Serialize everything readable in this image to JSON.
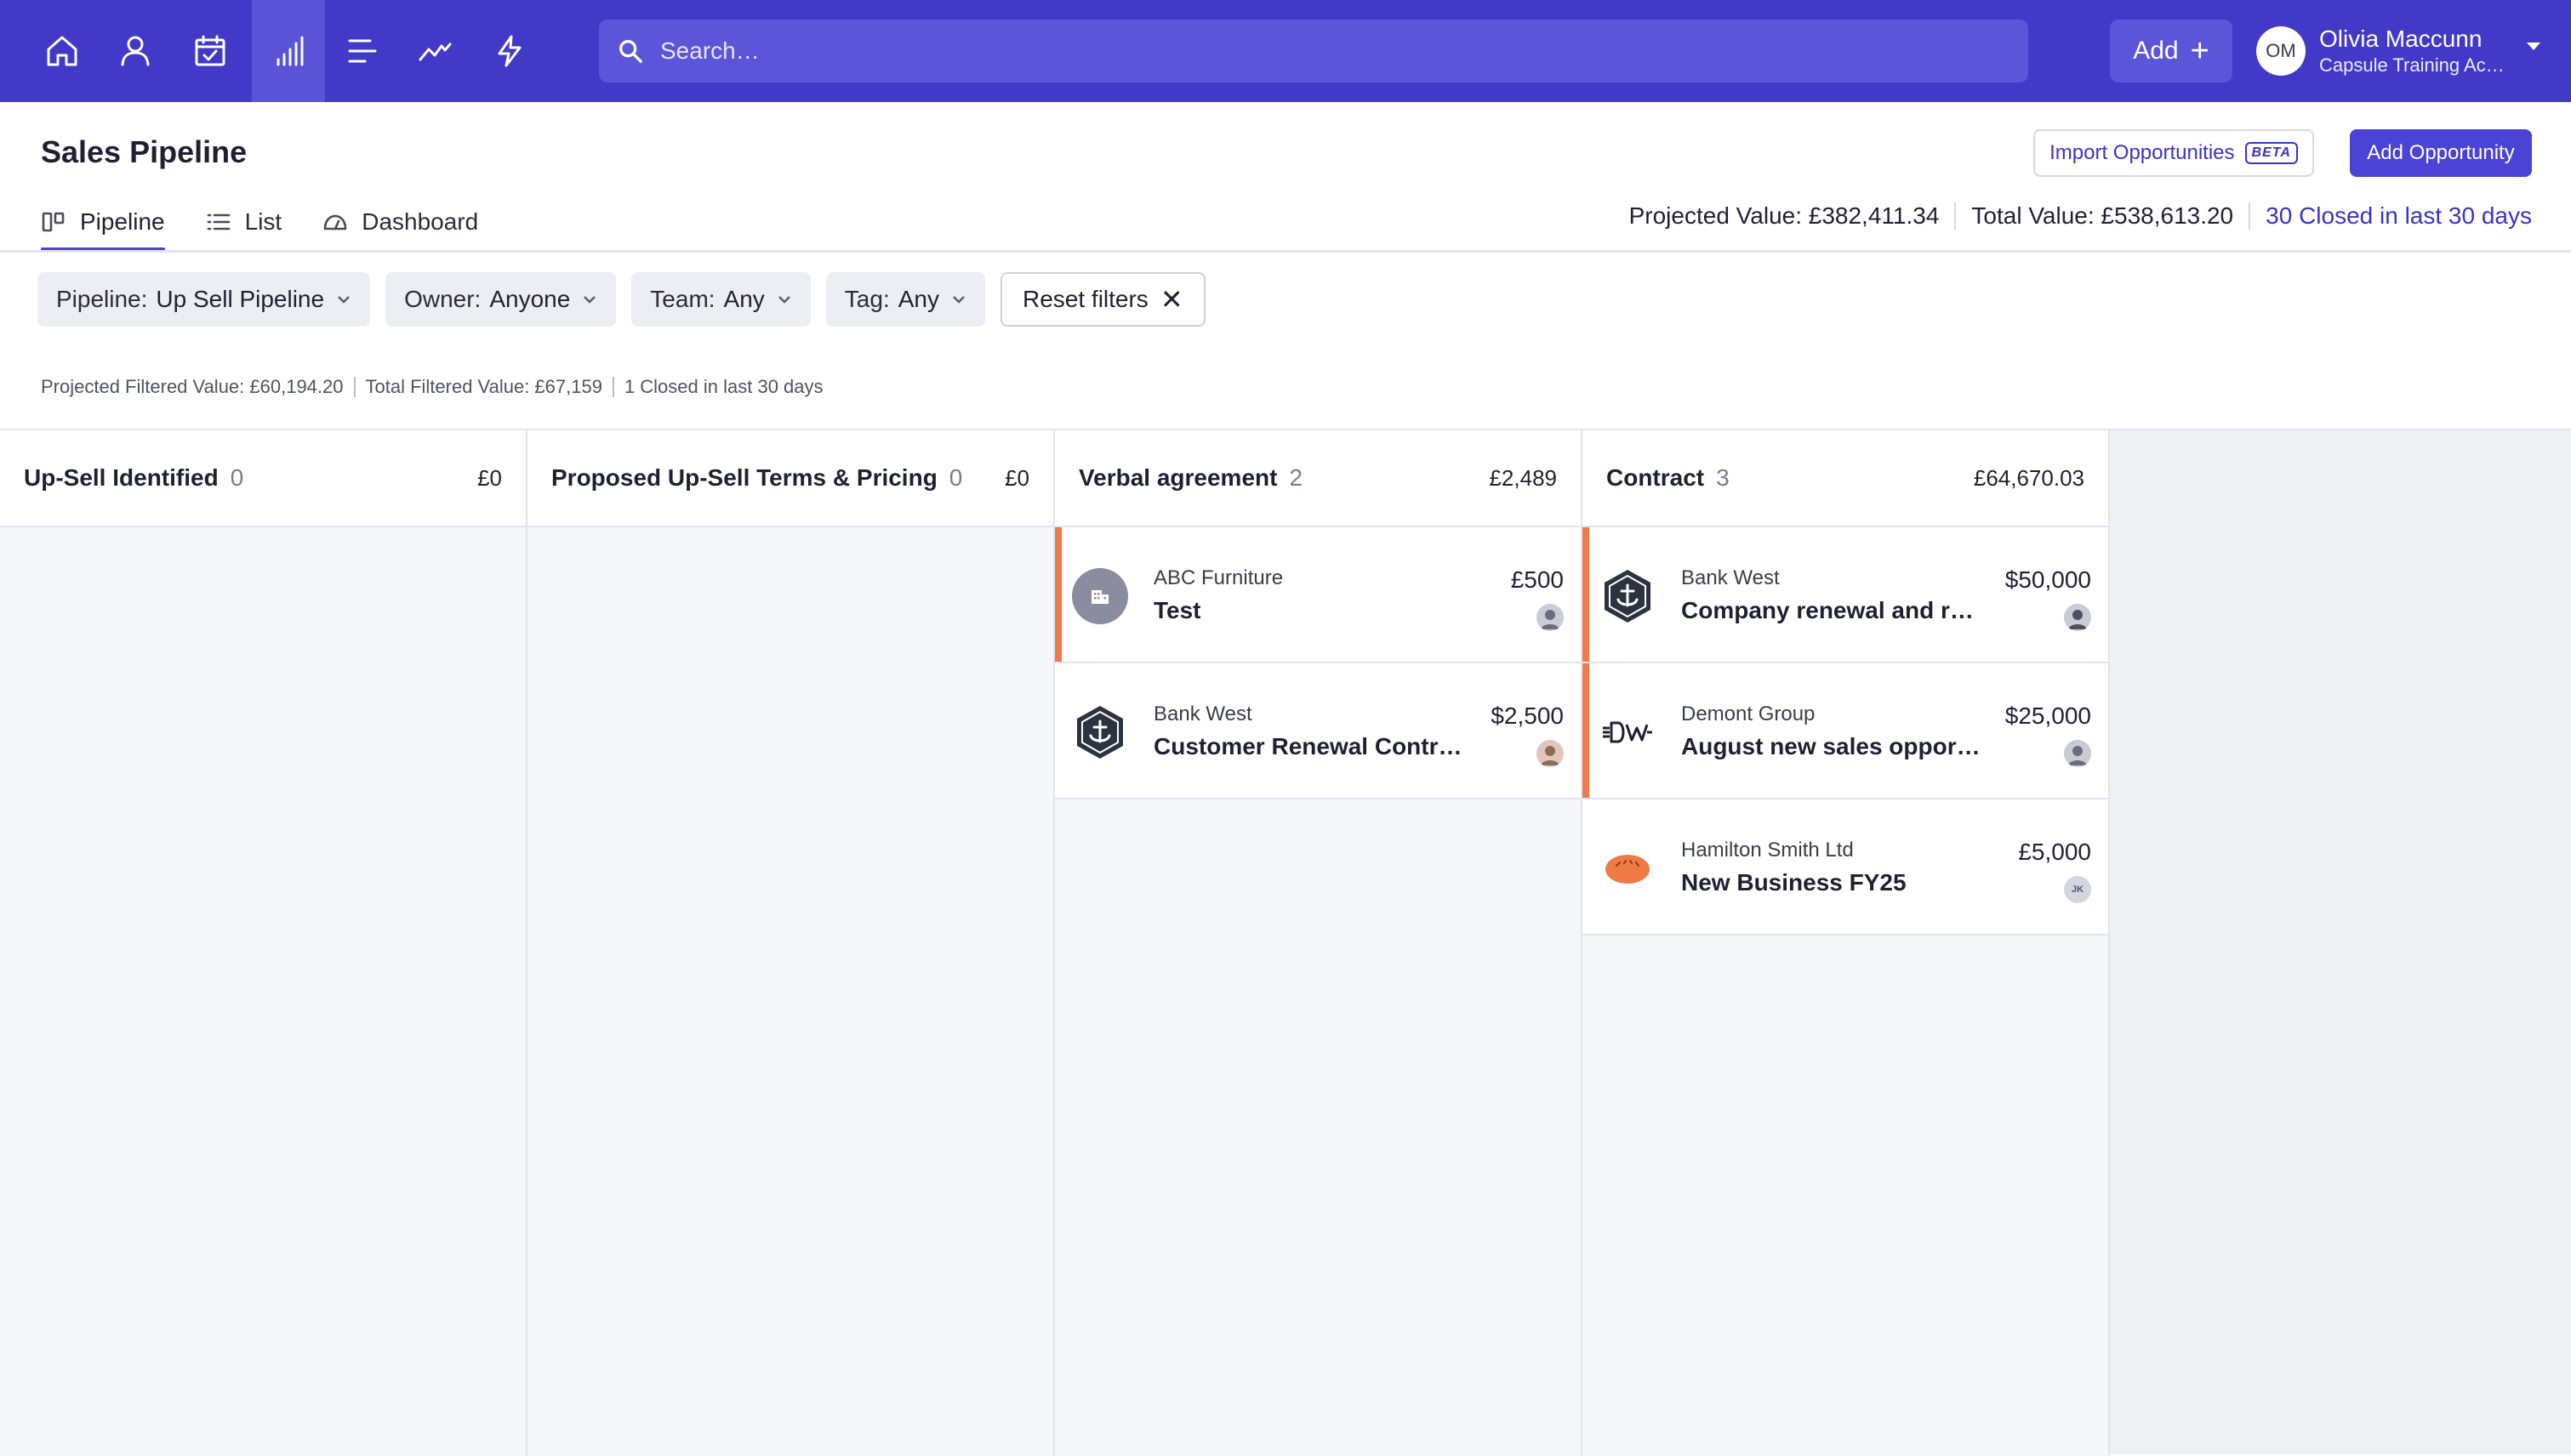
{
  "nav": {
    "items": [
      {
        "name": "home-icon"
      },
      {
        "name": "person-icon"
      },
      {
        "name": "calendar-check-icon"
      },
      {
        "name": "bar-chart-icon",
        "active": true
      },
      {
        "name": "list-icon"
      },
      {
        "name": "trend-line-icon"
      },
      {
        "name": "lightning-icon"
      }
    ],
    "search_placeholder": "Search…",
    "add_label": "Add",
    "user": {
      "initials": "OM",
      "name": "Olivia Maccunn",
      "org": "Capsule Training Ac…"
    }
  },
  "header": {
    "title": "Sales Pipeline",
    "import_label": "Import Opportunities",
    "beta_label": "BETA",
    "add_opportunity_label": "Add Opportunity"
  },
  "tabs": [
    {
      "label": "Pipeline",
      "icon": "pipeline-icon",
      "active": true
    },
    {
      "label": "List",
      "icon": "list-icon"
    },
    {
      "label": "Dashboard",
      "icon": "dashboard-icon"
    }
  ],
  "totals": {
    "projected": "Projected Value: £382,411.34",
    "total": "Total Value: £538,613.20",
    "closed": "30 Closed in last 30 days"
  },
  "filters": {
    "pipeline": {
      "label": "Pipeline:",
      "value": "Up Sell Pipeline"
    },
    "owner": {
      "label": "Owner:",
      "value": "Anyone"
    },
    "team": {
      "label": "Team:",
      "value": "Any"
    },
    "tag": {
      "label": "Tag:",
      "value": "Any"
    },
    "reset_label": "Reset filters"
  },
  "filtered_summary": {
    "projected": "Projected Filtered Value: £60,194.20",
    "total": "Total Filtered Value: £67,159",
    "closed": "1 Closed in last 30 days"
  },
  "columns": [
    {
      "title": "Up-Sell Identified",
      "count": "0",
      "total": "£0",
      "cards": []
    },
    {
      "title": "Proposed Up-Sell Terms & Pricing",
      "count": "0",
      "total": "£0",
      "cards": []
    },
    {
      "title": "Verbal agreement",
      "count": "2",
      "total": "£2,489",
      "cards": [
        {
          "company": "ABC Furniture",
          "name": "Test",
          "value": "£500",
          "logo": "building-icon",
          "stale": true
        },
        {
          "company": "Bank West",
          "name": "Customer Renewal Contr…",
          "value": "$2,500",
          "logo": "bank-west-logo",
          "stale": false
        }
      ]
    },
    {
      "title": "Contract",
      "count": "3",
      "total": "£64,670.03",
      "cards": [
        {
          "company": "Bank West",
          "name": "Company renewal and r…",
          "value": "$50,000",
          "logo": "bank-west-logo",
          "stale": true
        },
        {
          "company": "Demont Group",
          "name": "August new sales oppor…",
          "value": "$25,000",
          "logo": "demont-logo",
          "stale": true
        },
        {
          "company": "Hamilton Smith Ltd",
          "name": "New Business FY25",
          "value": "£5,000",
          "logo": "hamilton-logo",
          "stale": false,
          "owner_initials": "JK"
        }
      ]
    }
  ],
  "colors": {
    "nav_bg": "#4239c9",
    "accent": "#4a43d6",
    "stale": "#f07a4a"
  }
}
